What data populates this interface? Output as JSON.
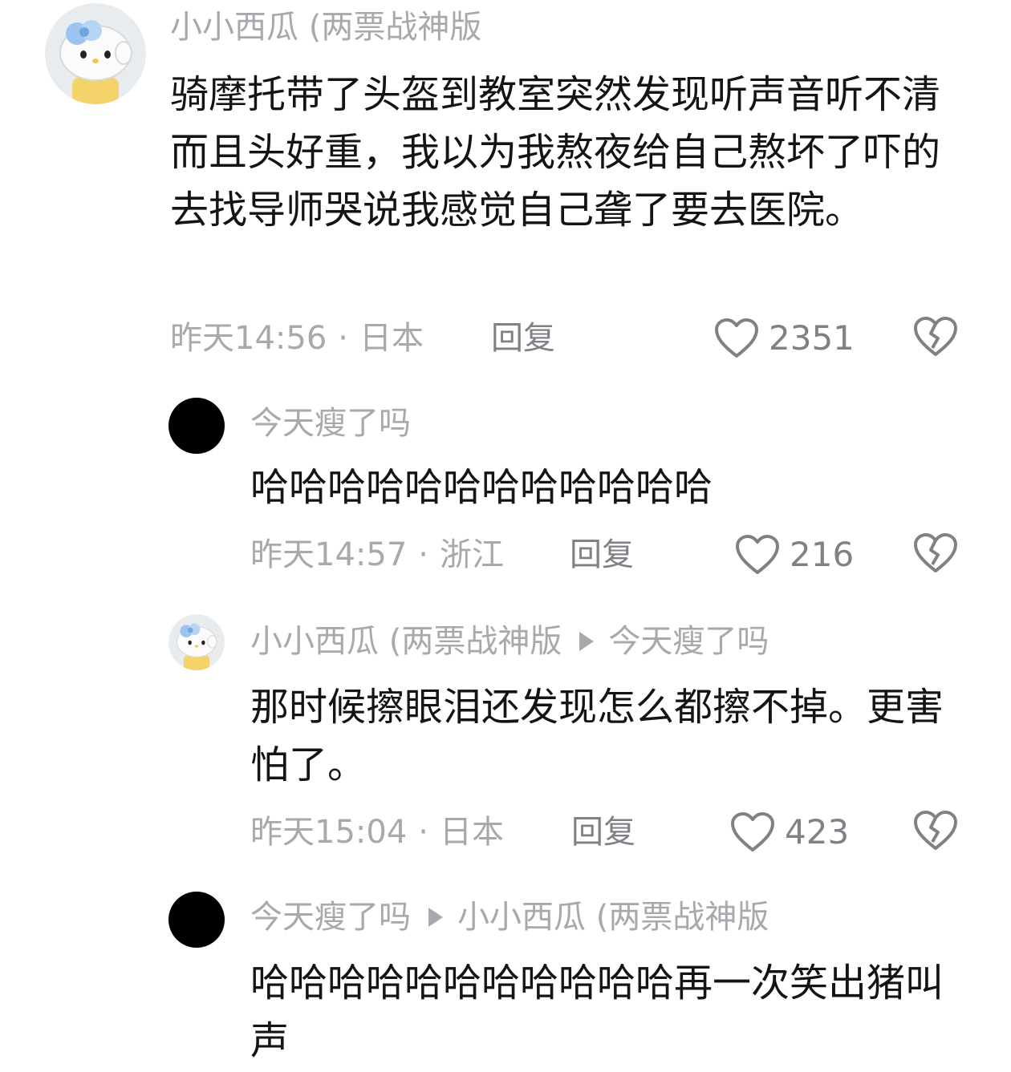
{
  "comments": [
    {
      "username": "小小西瓜 (两票战神版",
      "reply_to": "",
      "text": "骑摩托带了头盔到教室突然发现听声音听不清而且头好重，我以为我熬夜给自己熬坏了吓的去找导师哭说我感觉自己聋了要去医院。",
      "time": "昨天14:56",
      "location": "日本",
      "reply_label": "回复",
      "likes": "2351",
      "avatar": "hello-kitty"
    },
    {
      "username": "今天瘦了吗",
      "reply_to": "",
      "text": "哈哈哈哈哈哈哈哈哈哈哈哈",
      "time": "昨天14:57",
      "location": "浙江",
      "reply_label": "回复",
      "likes": "216",
      "avatar": "black-circle"
    },
    {
      "username": "小小西瓜 (两票战神版",
      "reply_to": "今天瘦了吗",
      "text": "那时候擦眼泪还发现怎么都擦不掉。更害怕了。",
      "time": "昨天15:04",
      "location": "日本",
      "reply_label": "回复",
      "likes": "423",
      "avatar": "hello-kitty"
    },
    {
      "username": "今天瘦了吗",
      "reply_to": "小小西瓜 (两票战神版",
      "text": "哈哈哈哈哈哈哈哈哈哈哈再一次笑出猪叫声",
      "avatar": "black-circle"
    }
  ],
  "colors": {
    "meta": "#a8a8ad",
    "text": "#141414",
    "icon": "#808086"
  }
}
